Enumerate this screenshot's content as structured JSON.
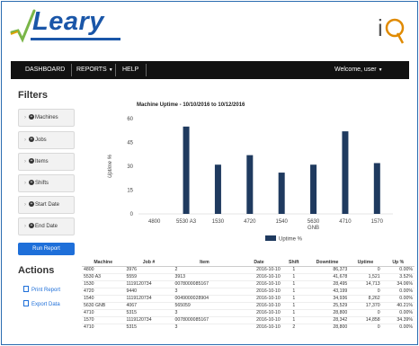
{
  "brand": {
    "name": "Leary",
    "right_logo": "iQ"
  },
  "nav": {
    "dashboard": "DASHBOARD",
    "reports": "REPORTS",
    "help": "HELP",
    "welcome": "Welcome, user"
  },
  "filters": {
    "title": "Filters",
    "items": [
      {
        "label": "Machines"
      },
      {
        "label": "Jobs"
      },
      {
        "label": "Items"
      },
      {
        "label": "Shifts"
      },
      {
        "label": "Start Date"
      },
      {
        "label": "End Date"
      }
    ],
    "run_label": "Run Report"
  },
  "actions": {
    "title": "Actions",
    "print": "Print Report",
    "export": "Export Data"
  },
  "chart_data": {
    "type": "bar",
    "title": "Machine Uptime - 10/10/2016 to 10/12/2016",
    "ylabel": "Uptime %",
    "xlabel": "",
    "ylim": [
      0,
      60
    ],
    "yticks": [
      0,
      15,
      30,
      45,
      60
    ],
    "categories": [
      "4800",
      "5530 A3",
      "1530",
      "4720",
      "1540",
      "5630 GNB",
      "4710",
      "1570"
    ],
    "series": [
      {
        "name": "Uptime %",
        "values": [
          0,
          55,
          31,
          37,
          26,
          31,
          52,
          32
        ]
      }
    ],
    "bar_color": "#1f3a5f",
    "legend": "bottom"
  },
  "table": {
    "headers": [
      "Machine",
      "Job #",
      "Item",
      "Date",
      "Shift",
      "Downtime",
      "Uptime",
      "Up %"
    ],
    "rows": [
      [
        "4800",
        "3976",
        "2",
        "2016-10-10",
        "1",
        "86,373",
        "0",
        "0.00%"
      ],
      [
        "5530 A3",
        "5559",
        "3913",
        "2016-10-10",
        "1",
        "41,678",
        "1,521",
        "3.52%"
      ],
      [
        "1530",
        "1119120734",
        "0078000085167",
        "2016-10-10",
        "1",
        "28,495",
        "14,713",
        "34.06%"
      ],
      [
        "4720",
        "9440",
        "3",
        "2016-10-10",
        "1",
        "43,199",
        "0",
        "0.00%"
      ],
      [
        "1540",
        "1119120734",
        "0049000028904",
        "2016-10-10",
        "1",
        "34,936",
        "8,262",
        "0.00%"
      ],
      [
        "5630 GNB",
        "4067",
        "565059",
        "2016-10-10",
        "1",
        "25,529",
        "17,370",
        "40.21%"
      ],
      [
        "4710",
        "5315",
        "3",
        "2016-10-10",
        "1",
        "28,800",
        "0",
        "0.00%"
      ],
      [
        "1570",
        "1119120734",
        "0078000085167",
        "2016-10-10",
        "1",
        "28,342",
        "14,858",
        "34.39%"
      ],
      [
        "4710",
        "5315",
        "3",
        "2016-10-10",
        "2",
        "28,800",
        "0",
        "0.00%"
      ]
    ]
  }
}
